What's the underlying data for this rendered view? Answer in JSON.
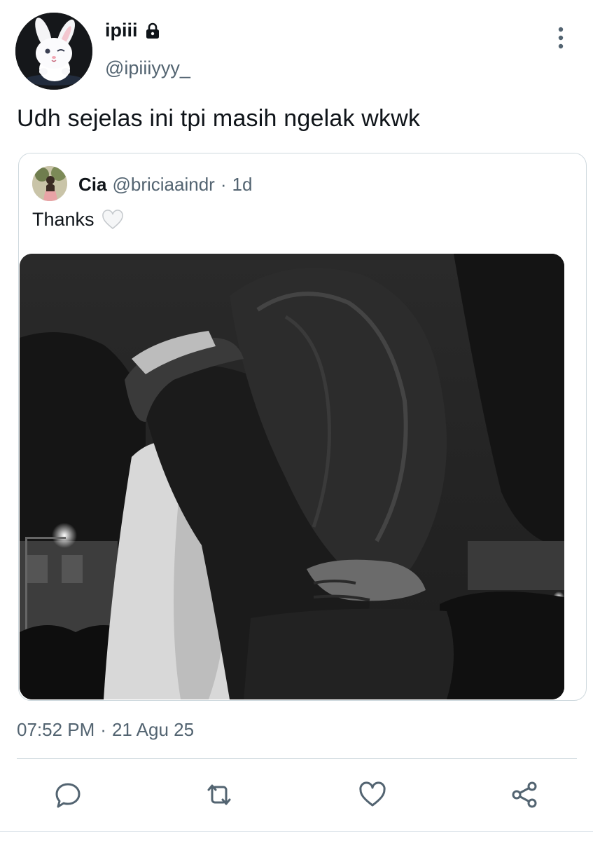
{
  "author": {
    "display_name": "ipiii",
    "handle": "@ipiiiyyy_",
    "protected_icon": "lock-icon",
    "avatar_description": "white bunny avatar"
  },
  "tweet": {
    "text": "Udh sejelas ini tpi masih ngelak wkwk",
    "time": "07:52 PM",
    "separator": "·",
    "date": "21 Agu 25"
  },
  "quoted_tweet": {
    "display_name": "Cia",
    "handle": "@briciaaindr",
    "separator": "·",
    "age": "1d",
    "text": "Thanks",
    "emoji_icon": "white-heart-icon",
    "media_icon": "photo-icon"
  },
  "actions": {
    "reply_icon": "reply-icon",
    "retweet_icon": "retweet-icon",
    "like_icon": "heart-icon",
    "share_icon": "share-icon"
  },
  "colors": {
    "primary_text": "#0f1419",
    "secondary_text": "#536471",
    "border": "#cfd9de",
    "icon": "#536471"
  }
}
